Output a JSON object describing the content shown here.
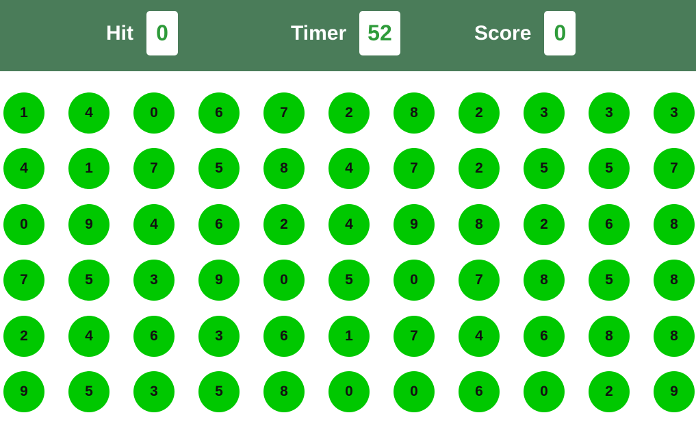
{
  "header": {
    "hit_label": "Hit",
    "hit_value": "0",
    "timer_label": "Timer",
    "timer_value": "52",
    "score_label": "Score",
    "score_value": "0"
  },
  "colors": {
    "header_bg": "#4a7c59",
    "value_text": "#2e9b3a",
    "ball": "#00c800"
  },
  "board": [
    [
      "1",
      "4",
      "0",
      "6",
      "7",
      "2",
      "8",
      "2",
      "3",
      "3",
      "3"
    ],
    [
      "4",
      "1",
      "7",
      "5",
      "8",
      "4",
      "7",
      "2",
      "5",
      "5",
      "7"
    ],
    [
      "0",
      "9",
      "4",
      "6",
      "2",
      "4",
      "9",
      "8",
      "2",
      "6",
      "8"
    ],
    [
      "7",
      "5",
      "3",
      "9",
      "0",
      "5",
      "0",
      "7",
      "8",
      "5",
      "8"
    ],
    [
      "2",
      "4",
      "6",
      "3",
      "6",
      "1",
      "7",
      "4",
      "6",
      "8",
      "8"
    ],
    [
      "9",
      "5",
      "3",
      "5",
      "8",
      "0",
      "0",
      "6",
      "0",
      "2",
      "9"
    ]
  ]
}
